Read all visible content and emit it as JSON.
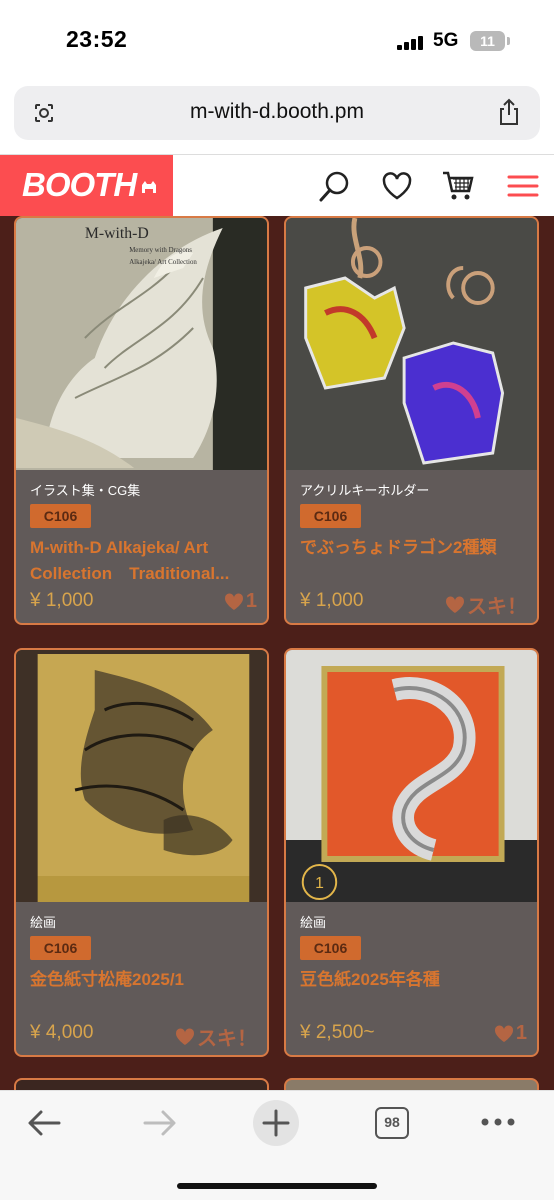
{
  "status_bar": {
    "time": "23:52",
    "network": "5G",
    "battery": "11"
  },
  "browser": {
    "url": "m-with-d.booth.pm",
    "tab_count": "98"
  },
  "header": {
    "logo": "BOOTH",
    "brand_color": "#fc4d50"
  },
  "theme": {
    "background": "#4c1f19",
    "card_bg": "#615a59",
    "card_border": "#d87a45",
    "badge_bg": "#d06a2e"
  },
  "products": [
    {
      "category": "イラスト集・CG集",
      "badge": "C106",
      "title": "M-with-D Alkajeka/ Art Collection　Traditional...",
      "price": "¥ 1,000",
      "likes": "1",
      "image_text_1": "M-with-D",
      "image_text_2": "Memory with Dragons",
      "image_text_3": "Alkajeka/ Art Collection"
    },
    {
      "category": "アクリルキーホルダー",
      "badge": "C106",
      "title": "でぶっちょドラゴン2種類",
      "price": "¥ 1,000",
      "likes": "スキ！"
    },
    {
      "category": "絵画",
      "badge": "C106",
      "title": "金色紙寸松庵2025/1",
      "price": "¥ 4,000",
      "likes": "スキ！"
    },
    {
      "category": "絵画",
      "badge": "C106",
      "title": "豆色紙2025年各種",
      "price": "¥ 2,500~",
      "likes": "1",
      "overlay": "1"
    }
  ]
}
